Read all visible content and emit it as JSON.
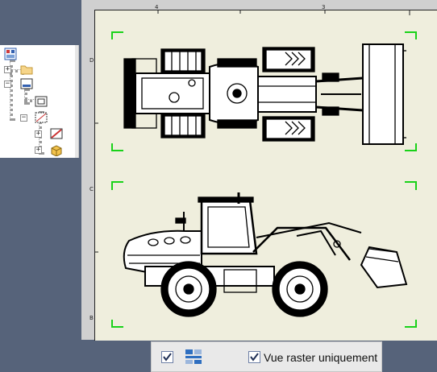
{
  "browser": {
    "nodes": [
      {
        "name": "drawing-icon"
      },
      {
        "name": "folder-icon"
      },
      {
        "name": "sheet-icon"
      },
      {
        "name": "border-icon"
      },
      {
        "name": "view-icon"
      },
      {
        "name": "section-view-icon"
      },
      {
        "name": "part-icon"
      }
    ]
  },
  "sheet": {
    "ruler_top": [
      "4",
      "3"
    ],
    "ruler_left": [
      "D",
      "C",
      "B"
    ]
  },
  "bottom_bar": {
    "raster_only_label": "Vue raster uniquement",
    "raster_only_checked": true,
    "first_checkbox_checked": true
  },
  "colors": {
    "background": "#56637a",
    "sheet": "#efeedd",
    "corner_marks": "#19d219",
    "ink": "#000000"
  }
}
